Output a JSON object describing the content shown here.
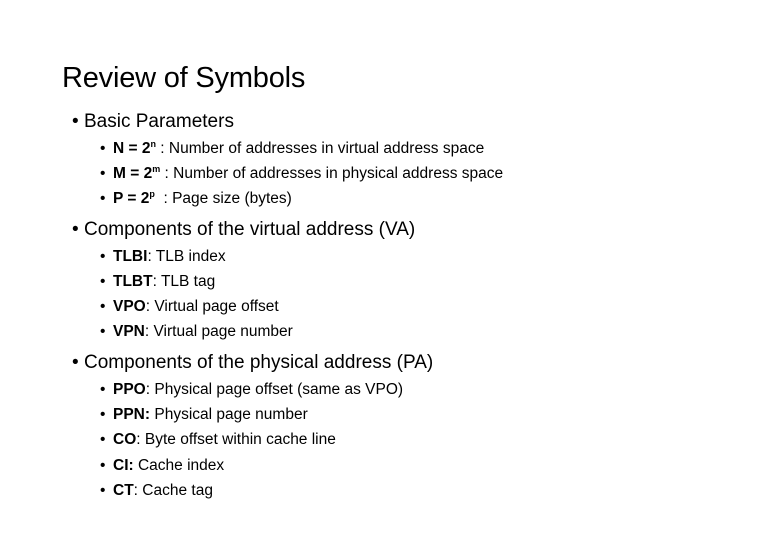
{
  "slide": {
    "title": "Review of Symbols",
    "sections": [
      {
        "heading": "Basic Parameters",
        "items": [
          {
            "term": "N = 2",
            "sup": "n",
            "sep": " : ",
            "desc": "Number of addresses in virtual address space"
          },
          {
            "term": "M = 2",
            "sup": "m",
            "sep": " : ",
            "desc": "Number of addresses in physical address space"
          },
          {
            "term": "P = 2",
            "sup": "p",
            "sep": "  : ",
            "desc": "Page size (bytes)"
          }
        ]
      },
      {
        "heading": "Components of the virtual address (VA)",
        "items": [
          {
            "term": "TLBI",
            "sep": ": ",
            "desc": "TLB index"
          },
          {
            "term": "TLBT",
            "sep": ": ",
            "desc": "TLB tag"
          },
          {
            "term": "VPO",
            "sep": ": ",
            "desc": "Virtual page offset"
          },
          {
            "term": "VPN",
            "sep": ": ",
            "desc": "Virtual page number"
          }
        ]
      },
      {
        "heading": "Components of the physical address (PA)",
        "items": [
          {
            "term": "PPO",
            "sep": ": ",
            "desc": "Physical page offset (same as VPO)"
          },
          {
            "term": "PPN:",
            "sep": " ",
            "desc": "Physical page number"
          },
          {
            "term": "CO",
            "sep": ": ",
            "desc": "Byte offset within cache line"
          },
          {
            "term": "CI:",
            "sep": " ",
            "desc": "Cache index"
          },
          {
            "term": "CT",
            "sep": ": ",
            "desc": "Cache tag"
          }
        ]
      }
    ],
    "bullet_glyph": "•"
  }
}
